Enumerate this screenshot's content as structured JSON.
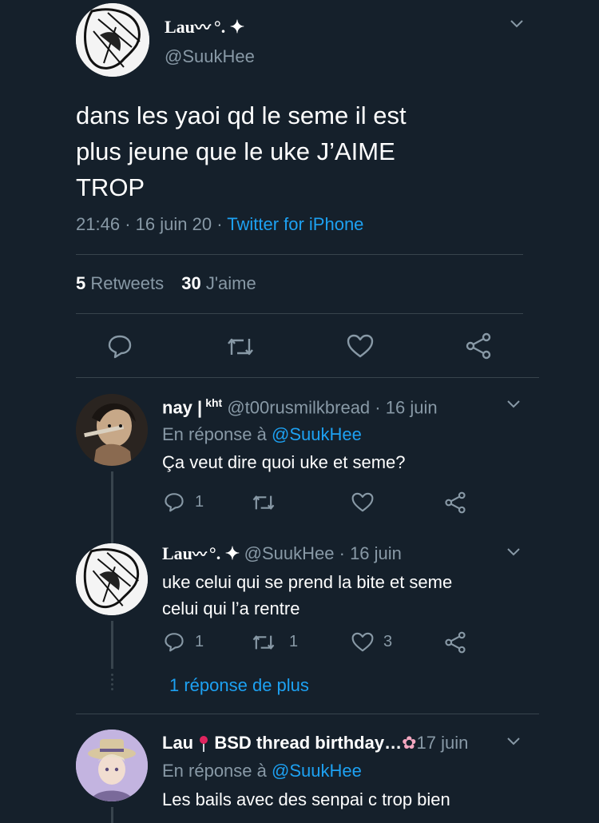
{
  "main_tweet": {
    "display_name": "Lau",
    "name_suffix": "°. ✦",
    "handle": "@SuukHee",
    "text_line1": "dans les yaoi qd le seme il est",
    "text_line2": "plus jeune que le uke J’AIME",
    "text_line3": "TROP",
    "time": "21:46",
    "date": "16 juin 20",
    "separator": "·",
    "source": "Twitter for iPhone",
    "retweets_count": "5",
    "retweets_label": "Retweets",
    "likes_count": "30",
    "likes_label": "J'aime"
  },
  "replies": [
    {
      "display_name": "nay |",
      "name_sup": "kht",
      "handle": "@t00rusmilkbread",
      "date": "· 16 juin",
      "reply_prefix": "En réponse à",
      "reply_to": "@SuukHee",
      "text": "Ça veut dire quoi uke et seme?",
      "reply_count": "1",
      "retweet_count": "",
      "like_count": ""
    },
    {
      "display_name": "Lau",
      "name_suffix": "°. ✦",
      "handle": "@SuukHee",
      "date": "· 16 juin",
      "text_line1": "uke celui qui se prend la bite et seme",
      "text_line2": "celui qui l’a rentre",
      "reply_count": "1",
      "retweet_count": "1",
      "like_count": "3"
    },
    {
      "display_name": "Lau",
      "name_rest": "BSD thread birthday…",
      "date": "17 juin",
      "reply_prefix": "En réponse à",
      "reply_to": "@SuukHee",
      "text": "Les bails avec des senpai c trop bien"
    }
  ],
  "more_replies_label": "1 réponse de plus",
  "colors": {
    "background": "#15202b",
    "text": "#ffffff",
    "muted": "#8899a6",
    "link": "#1da1f2",
    "divider": "#38444d"
  }
}
